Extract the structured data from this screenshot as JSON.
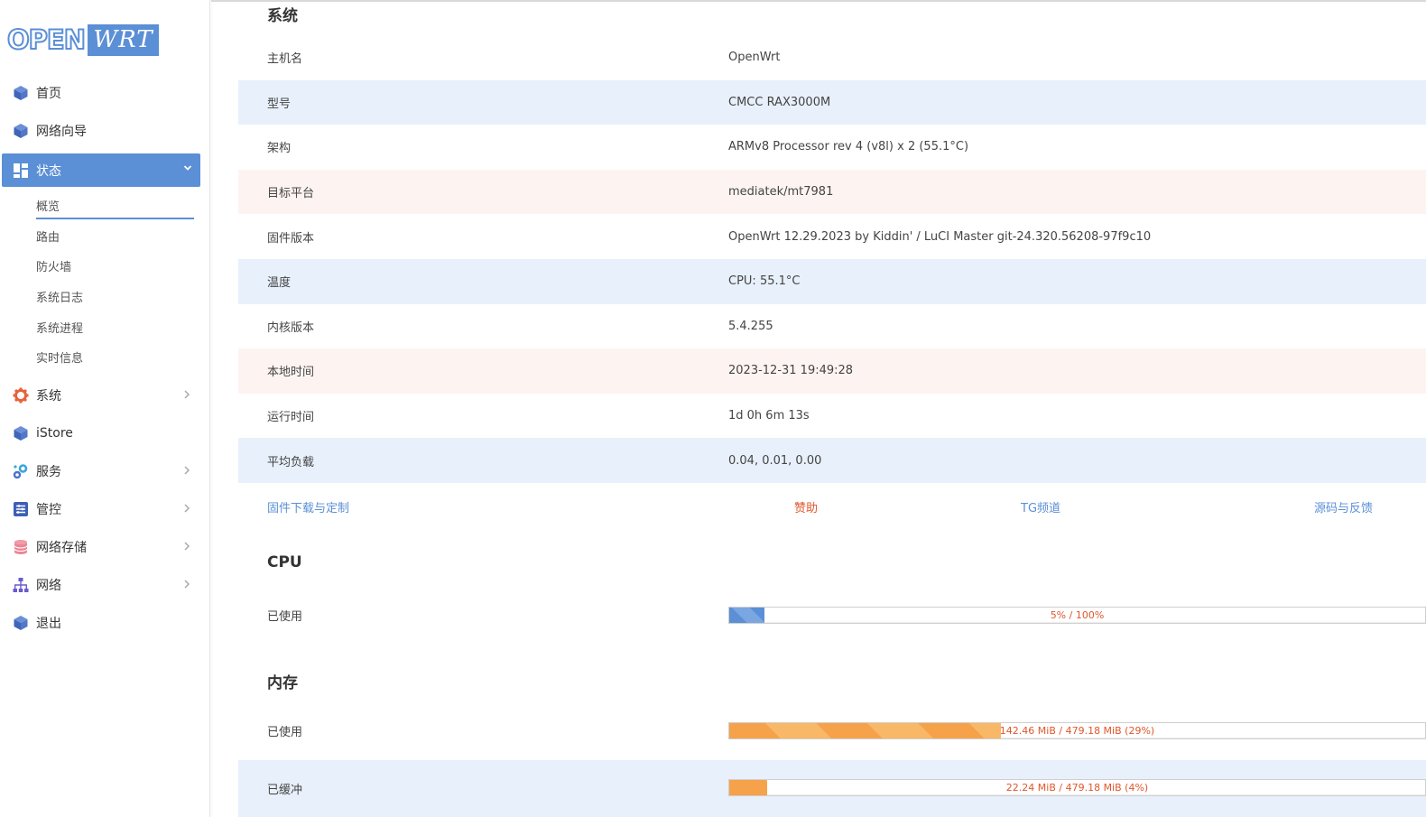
{
  "logo": {
    "part1": "OPEN",
    "part2": "WRT"
  },
  "nav": {
    "home": "首页",
    "wizard": "网络向导",
    "status": "状态",
    "status_sub": [
      "概览",
      "路由",
      "防火墙",
      "系统日志",
      "系统进程",
      "实时信息"
    ],
    "system": "系统",
    "istore": "iStore",
    "services": "服务",
    "control": "管控",
    "nas": "网络存储",
    "network": "网络",
    "logout": "退出"
  },
  "system": {
    "title": "系统",
    "rows": [
      {
        "label": "主机名",
        "value": "OpenWrt"
      },
      {
        "label": "型号",
        "value": "CMCC RAX3000M"
      },
      {
        "label": "架构",
        "value": "ARMv8 Processor rev 4 (v8l) x 2 (55.1°C)"
      },
      {
        "label": "目标平台",
        "value": "mediatek/mt7981"
      },
      {
        "label": "固件版本",
        "value": "OpenWrt 12.29.2023 by Kiddin' / LuCI Master git-24.320.56208-97f9c10"
      },
      {
        "label": "温度",
        "value": "CPU: 55.1°C"
      },
      {
        "label": "内核版本",
        "value": "5.4.255"
      },
      {
        "label": "本地时间",
        "value": "2023-12-31 19:49:28"
      },
      {
        "label": "运行时间",
        "value": "1d 0h 6m 13s"
      },
      {
        "label": "平均负载",
        "value": "0.04, 0.01, 0.00"
      }
    ]
  },
  "links": {
    "firmware": "固件下载与定制",
    "sponsor": "赞助",
    "tg": "TG频道",
    "source": "源码与反馈"
  },
  "cpu": {
    "title": "CPU",
    "used_label": "已使用",
    "used_text": "5% / 100%",
    "used_fraction": 0.05
  },
  "memory": {
    "title": "内存",
    "used_label": "已使用",
    "used_text": "142.46 MiB / 479.18 MiB (29%)",
    "used_fraction": 0.39,
    "buffered_label": "已缓冲",
    "buffered_text": "22.24 MiB / 479.18 MiB (4%)",
    "buffered_fraction": 0.055
  },
  "colors": {
    "accent": "#5b8fd6",
    "link_red": "#e0572b",
    "row_blue": "#e8f0fb",
    "row_pink": "#fdf4f2"
  }
}
